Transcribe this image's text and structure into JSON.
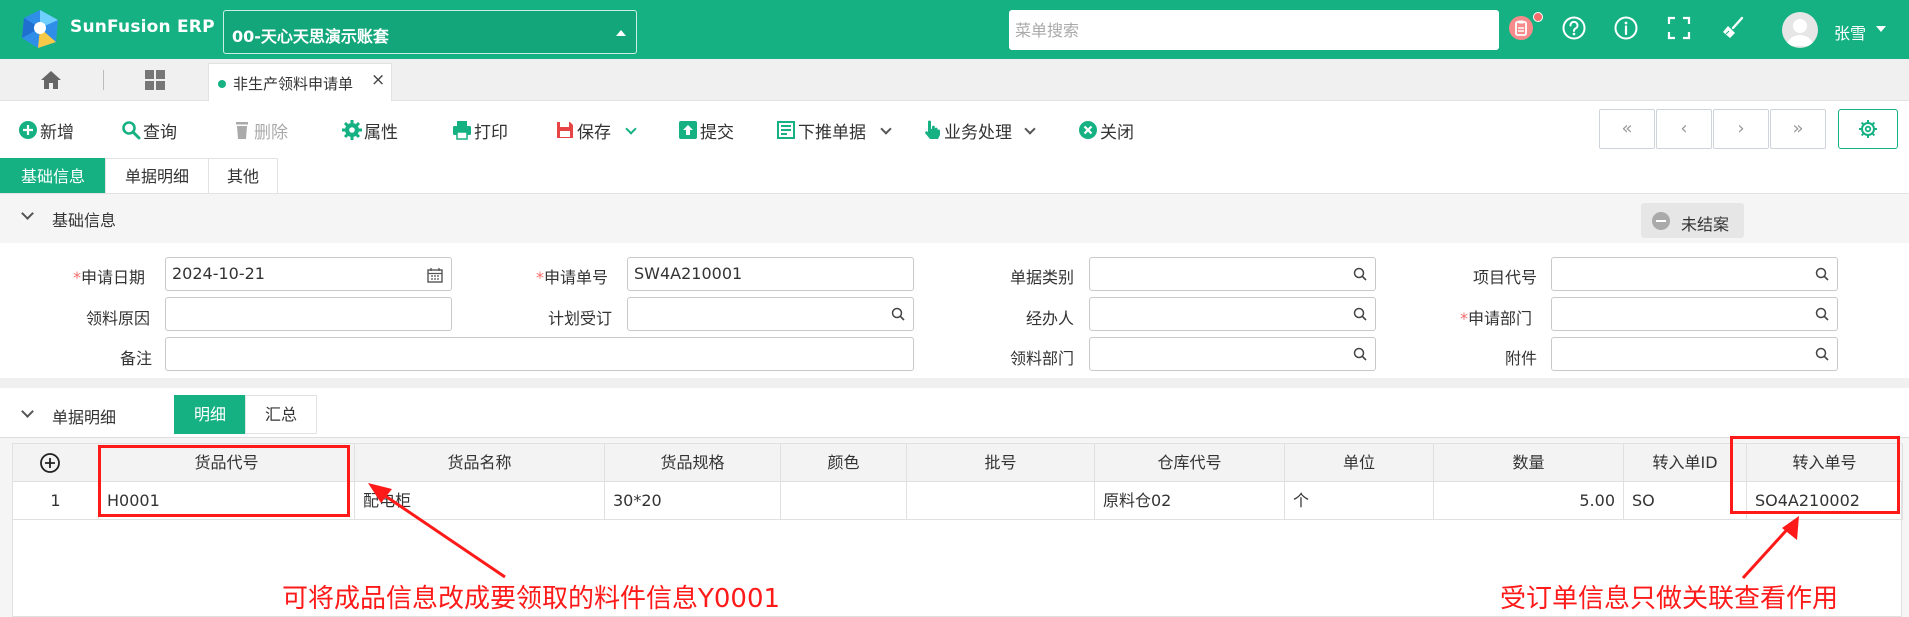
{
  "header": {
    "brand": "SunFusion ERP",
    "account": "00-天心天思演示账套",
    "search_placeholder": "菜单搜索",
    "user": "张雪",
    "icons": [
      "clipboard-icon",
      "help-icon",
      "info-icon",
      "fullscreen-icon",
      "broom-icon"
    ],
    "accent_color": "#16b183"
  },
  "tabs": {
    "open_tab": "非生产领料申请单"
  },
  "toolbar": {
    "new": "新增",
    "query": "查询",
    "delete": "删除",
    "props": "属性",
    "print": "打印",
    "save": "保存",
    "submit": "提交",
    "push_down": "下推单据",
    "business": "业务处理",
    "close": "关闭",
    "nav": [
      "«",
      "‹",
      "›",
      "»"
    ]
  },
  "section_tabs": [
    "基础信息",
    "单据明细",
    "其他"
  ],
  "basic": {
    "title": "基础信息",
    "status": "未结案",
    "fields": {
      "apply_date_label": "申请日期",
      "apply_date_value": "2024-10-21",
      "apply_no_label": "申请单号",
      "apply_no_value": "SW4A210001",
      "doc_type_label": "单据类别",
      "project_label": "项目代号",
      "reason_label": "领料原因",
      "plan_label": "计划受订",
      "handler_label": "经办人",
      "apply_dept_label": "申请部门",
      "remark_label": "备注",
      "pick_dept_label": "领料部门",
      "attach_label": "附件"
    }
  },
  "detail": {
    "title": "单据明细",
    "toggle": [
      "明细",
      "汇总"
    ],
    "columns": [
      "货品代号",
      "货品名称",
      "货品规格",
      "颜色",
      "批号",
      "仓库代号",
      "单位",
      "数量",
      "转入单ID",
      "转入单号"
    ],
    "rows": [
      {
        "no": "1",
        "code": "H0001",
        "name": "配电柜",
        "spec": "30*20",
        "color": "",
        "batch": "",
        "warehouse": "原料仓02",
        "unit": "个",
        "qty": "5.00",
        "src_id": "SO",
        "src_no": "SO4A210002"
      }
    ]
  },
  "annotations": {
    "left": "可将成品信息改成要领取的料件信息Y0001",
    "right": "受订单信息只做关联查看作用",
    "color": "#ff1a1a"
  }
}
